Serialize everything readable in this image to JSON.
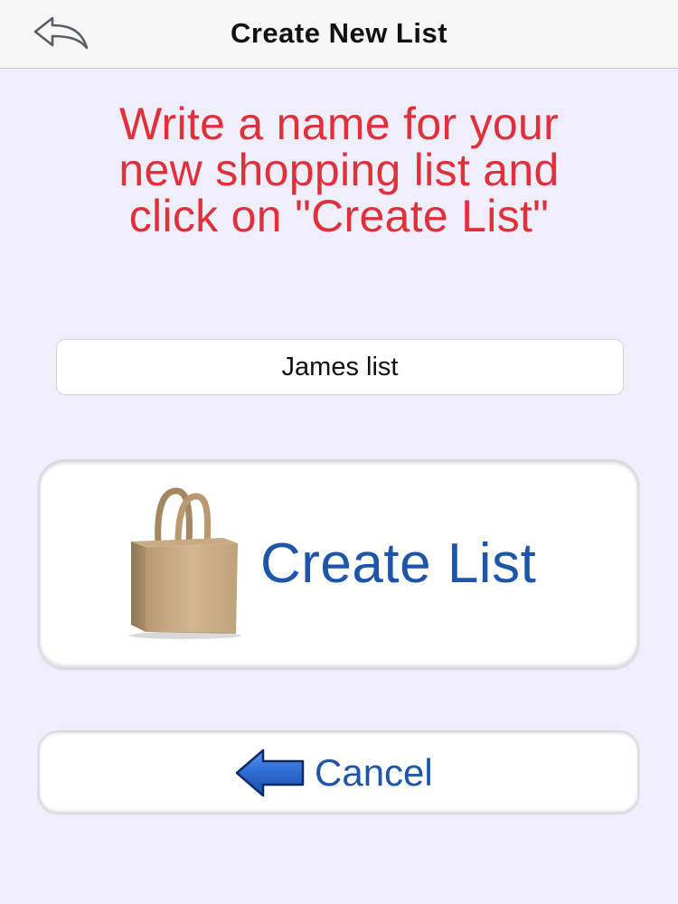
{
  "nav": {
    "title": "Create New List",
    "back_icon": "back-arrow-icon"
  },
  "instruction": {
    "line1": "Write a name for your",
    "line2": "new shopping list and",
    "line3": "click on \"Create List\""
  },
  "list_name": {
    "value": "James list"
  },
  "create_button": {
    "label": "Create List",
    "icon": "shopping-bag-icon"
  },
  "cancel_button": {
    "label": "Cancel",
    "icon": "left-arrow-icon"
  },
  "colors": {
    "background": "#f1eefb",
    "instruction": "#e0303a",
    "button_text": "#1d55a8",
    "arrow_blue": "#2f6fd6"
  }
}
